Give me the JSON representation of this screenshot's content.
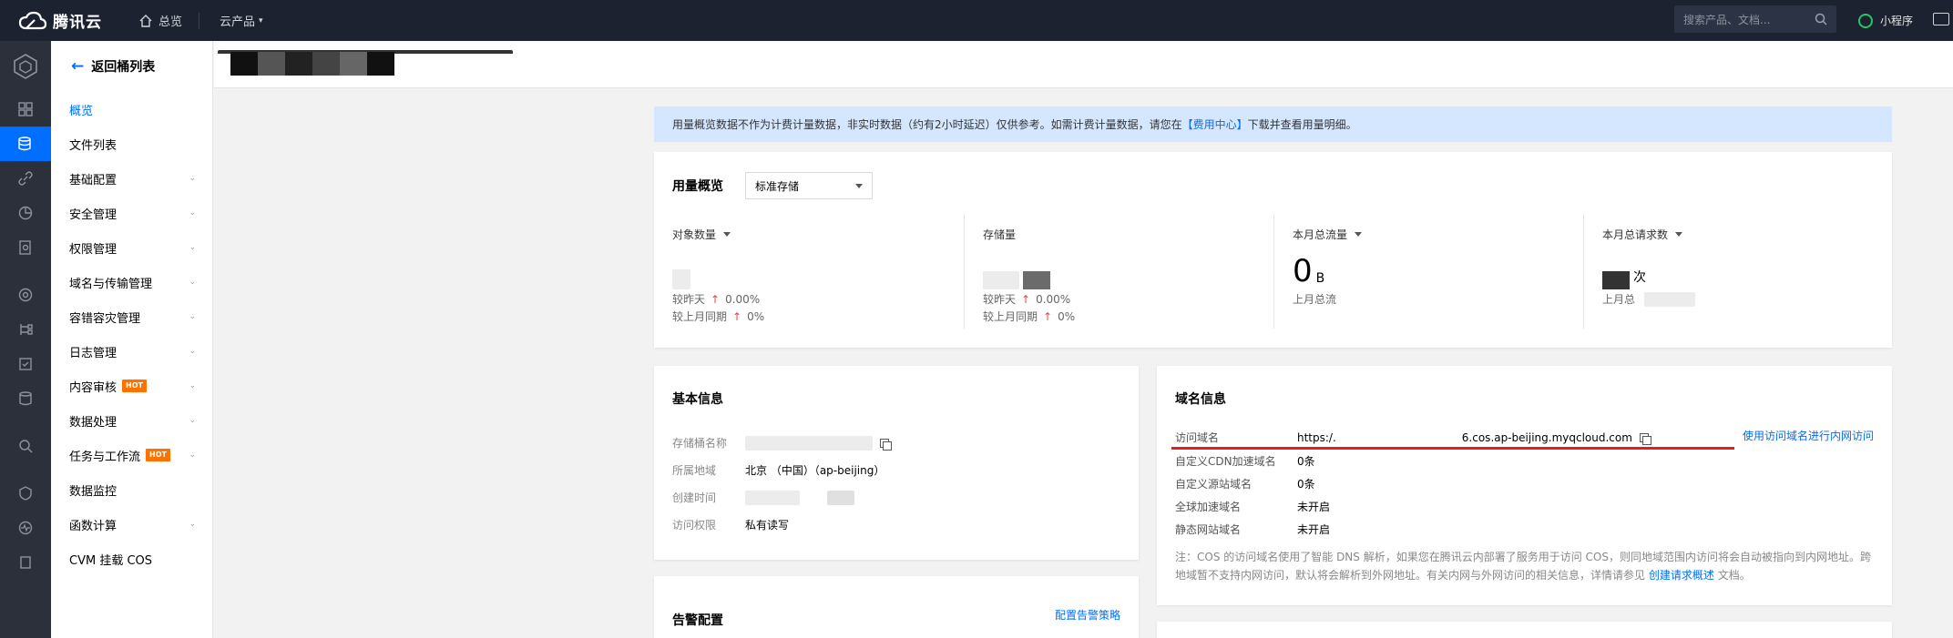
{
  "topbar": {
    "brand": "腾讯云",
    "nav_home": "总览",
    "nav_products": "云产品",
    "search_placeholder": "搜索产品、文档...",
    "mini_program": "小程序"
  },
  "subnav": {
    "back": "返回桶列表",
    "items": [
      {
        "label": "概览",
        "chevron": false,
        "hot": false
      },
      {
        "label": "文件列表",
        "chevron": false,
        "hot": false
      },
      {
        "label": "基础配置",
        "chevron": true,
        "hot": false
      },
      {
        "label": "安全管理",
        "chevron": true,
        "hot": false
      },
      {
        "label": "权限管理",
        "chevron": true,
        "hot": false
      },
      {
        "label": "域名与传输管理",
        "chevron": true,
        "hot": false
      },
      {
        "label": "容错容灾管理",
        "chevron": true,
        "hot": false
      },
      {
        "label": "日志管理",
        "chevron": true,
        "hot": false
      },
      {
        "label": "内容审核",
        "chevron": true,
        "hot": true
      },
      {
        "label": "数据处理",
        "chevron": true,
        "hot": false
      },
      {
        "label": "任务与工作流",
        "chevron": true,
        "hot": true
      },
      {
        "label": "数据监控",
        "chevron": false,
        "hot": false
      },
      {
        "label": "函数计算",
        "chevron": true,
        "hot": false
      },
      {
        "label": "CVM 挂载 COS",
        "chevron": false,
        "hot": false
      }
    ],
    "hot_label": "HOT"
  },
  "notice": {
    "text_before": "用量概览数据不作为计费计量数据，非实时数据（约有2小时延迟）仅供参考。如需计费计量数据，请您在",
    "link": "【费用中心】",
    "text_after": "下载并查看用量明细。"
  },
  "usage": {
    "title": "用量概览",
    "storage_class": "标准存储",
    "metrics": [
      {
        "label": "对象数量",
        "dropdown": true,
        "sub1_label": "较昨天",
        "sub1_value": "0.00%",
        "sub2_label": "较上月同期",
        "sub2_value": "0%"
      },
      {
        "label": "存储量",
        "dropdown": false,
        "sub1_label": "较昨天",
        "sub1_value": "0.00%",
        "sub2_label": "较上月同期",
        "sub2_value": "0%"
      },
      {
        "label": "本月总流量",
        "dropdown": true,
        "value": "0",
        "unit": "B",
        "sub1_label": "上月总流"
      },
      {
        "label": "本月总请求数",
        "dropdown": true,
        "unit": "次",
        "sub1_label": "上月总"
      }
    ]
  },
  "basic": {
    "title": "基本信息",
    "rows": [
      {
        "k": "存储桶名称",
        "v": ""
      },
      {
        "k": "所属地域",
        "v": "北京 （中国）（ap-beijing）"
      },
      {
        "k": "创建时间",
        "v": ""
      },
      {
        "k": "访问权限",
        "v": "私有读写"
      }
    ]
  },
  "domain": {
    "title": "域名信息",
    "intranet_link": "使用访问域名进行内网访问",
    "rows": [
      {
        "k": "访问域名",
        "v_prefix": "https:/.",
        "v_suffix": "6.cos.ap-beijing.myqcloud.com"
      },
      {
        "k": "自定义CDN加速域名",
        "v": "0条"
      },
      {
        "k": "自定义源站域名",
        "v": "0条"
      },
      {
        "k": "全球加速域名",
        "v": "未开启"
      },
      {
        "k": "静态网站域名",
        "v": "未开启"
      }
    ],
    "note_before": "注：COS 的访问域名使用了智能 DNS 解析，如果您在腾讯云内部署了服务用于访问 COS，则同地域范围内访问将会自动被指向到内网地址。跨地域暂不支持内网访问，默认将会解析到外网地址。有关内网与外网访问的相关信息，详情请参见",
    "note_link": "创建请求概述",
    "note_after": "文档。"
  },
  "alert": {
    "title": "告警配置",
    "link": "配置告警策略"
  },
  "colors": {
    "accent": "#006eff",
    "topbar": "#1c2230",
    "rail": "#2b303b",
    "hot": "#ff7200",
    "notice_bg": "#d5e7ff"
  }
}
